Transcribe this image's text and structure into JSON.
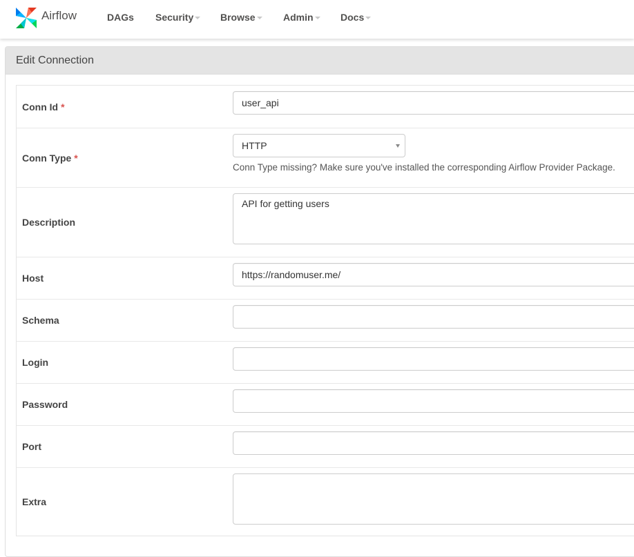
{
  "navbar": {
    "brand": "Airflow",
    "items": [
      {
        "label": "DAGs",
        "dropdown": false
      },
      {
        "label": "Security",
        "dropdown": true
      },
      {
        "label": "Browse",
        "dropdown": true
      },
      {
        "label": "Admin",
        "dropdown": true
      },
      {
        "label": "Docs",
        "dropdown": true
      }
    ]
  },
  "panel": {
    "title": "Edit Connection"
  },
  "form": {
    "conn_id": {
      "label": "Conn Id",
      "required": "*",
      "value": "user_api"
    },
    "conn_type": {
      "label": "Conn Type",
      "required": "*",
      "value": "HTTP",
      "help": "Conn Type missing? Make sure you've installed the corresponding Airflow Provider Package."
    },
    "description": {
      "label": "Description",
      "value": "API for getting users"
    },
    "host": {
      "label": "Host",
      "value": "https://randomuser.me/"
    },
    "schema": {
      "label": "Schema",
      "value": ""
    },
    "login": {
      "label": "Login",
      "value": ""
    },
    "password": {
      "label": "Password",
      "value": ""
    },
    "port": {
      "label": "Port",
      "value": ""
    },
    "extra": {
      "label": "Extra",
      "value": ""
    }
  },
  "colors": {
    "required": "#d9534f",
    "panel_heading_bg": "#e4e4e4",
    "nav_text": "#51504f",
    "logo_red": "#e43921",
    "logo_blue": "#017cee",
    "logo_green": "#00ad46",
    "logo_teal": "#04d659"
  },
  "icons": {
    "brand": "airflow-pinwheel-icon",
    "dropdown": "caret-down-icon",
    "select": "select-arrow-icon"
  }
}
